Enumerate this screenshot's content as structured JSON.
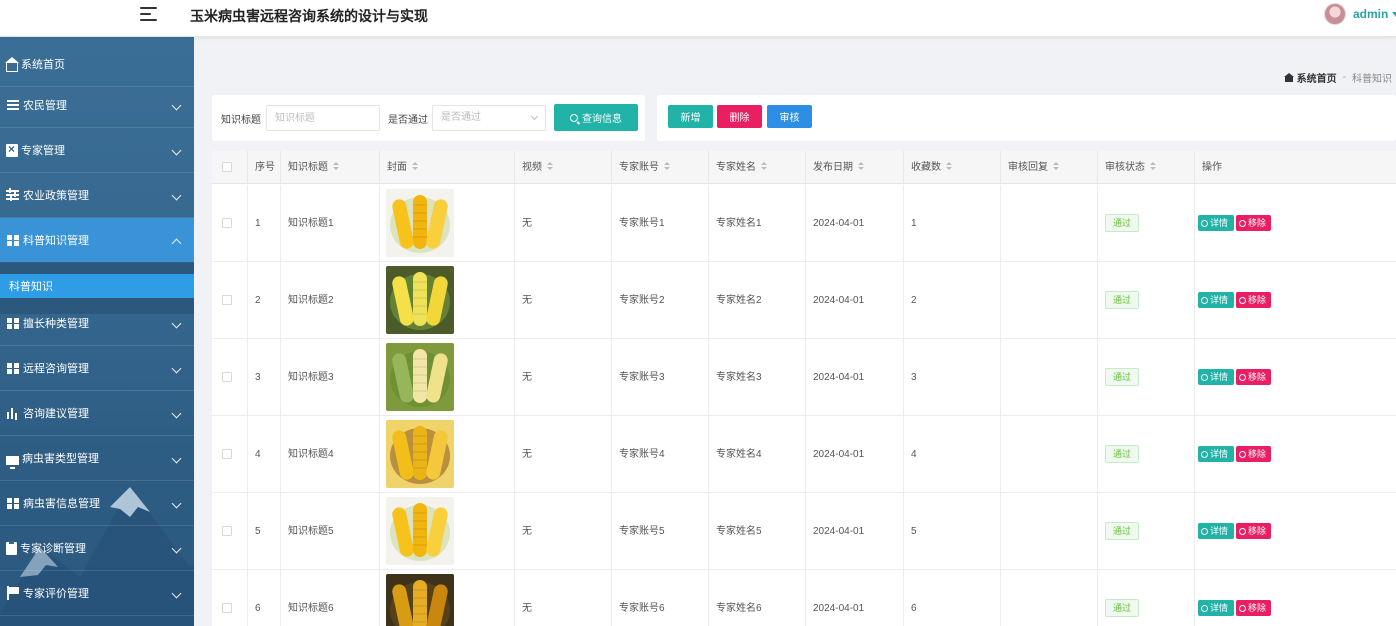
{
  "header": {
    "title": "玉米病虫害远程咨询系统的设计与实现",
    "username": "admin"
  },
  "sidebar": {
    "items": [
      {
        "label": "系统首页",
        "icon": "home-icon"
      },
      {
        "label": "农民管理",
        "icon": "list-icon"
      },
      {
        "label": "专家管理",
        "icon": "book-icon"
      },
      {
        "label": "农业政策管理",
        "icon": "sliders-icon"
      },
      {
        "label": "科普知识管理",
        "icon": "grid-icon"
      },
      {
        "label": "擅长种类管理",
        "icon": "grid-icon"
      },
      {
        "label": "远程咨询管理",
        "icon": "grid-icon"
      },
      {
        "label": "咨询建议管理",
        "icon": "bar-chart-icon"
      },
      {
        "label": "病虫害类型管理",
        "icon": "monitor-icon"
      },
      {
        "label": "病虫害信息管理",
        "icon": "grid-icon"
      },
      {
        "label": "专家诊断管理",
        "icon": "clipboard-icon"
      },
      {
        "label": "专家评价管理",
        "icon": "flag-icon"
      }
    ],
    "sub_item": "科普知识"
  },
  "breadcrumb": {
    "home": "系统首页",
    "separator": "-",
    "current": "科普知识"
  },
  "search": {
    "title_label": "知识标题",
    "title_placeholder": "知识标题",
    "pass_label": "是否通过",
    "pass_placeholder": "是否通过",
    "search_button": "查询信息"
  },
  "actions": {
    "add": "新增",
    "delete": "删除",
    "audit": "审核"
  },
  "table": {
    "columns": [
      "序号",
      "知识标题",
      "封面",
      "视频",
      "专家账号",
      "专家姓名",
      "发布日期",
      "收藏数",
      "审核回复",
      "审核状态",
      "操作"
    ],
    "rows": [
      {
        "index": "1",
        "title": "知识标题1",
        "video": "无",
        "account": "专家账号1",
        "name": "专家姓名1",
        "date": "2024-04-01",
        "favorites": "1",
        "reply": "",
        "status": "通过"
      },
      {
        "index": "2",
        "title": "知识标题2",
        "video": "无",
        "account": "专家账号2",
        "name": "专家姓名2",
        "date": "2024-04-01",
        "favorites": "2",
        "reply": "",
        "status": "通过"
      },
      {
        "index": "3",
        "title": "知识标题3",
        "video": "无",
        "account": "专家账号3",
        "name": "专家姓名3",
        "date": "2024-04-01",
        "favorites": "3",
        "reply": "",
        "status": "通过"
      },
      {
        "index": "4",
        "title": "知识标题4",
        "video": "无",
        "account": "专家账号4",
        "name": "专家姓名4",
        "date": "2024-04-01",
        "favorites": "4",
        "reply": "",
        "status": "通过"
      },
      {
        "index": "5",
        "title": "知识标题5",
        "video": "无",
        "account": "专家账号5",
        "name": "专家姓名5",
        "date": "2024-04-01",
        "favorites": "5",
        "reply": "",
        "status": "通过"
      },
      {
        "index": "6",
        "title": "知识标题6",
        "video": "无",
        "account": "专家账号6",
        "name": "专家姓名6",
        "date": "2024-04-01",
        "favorites": "6",
        "reply": "",
        "status": "通过"
      }
    ],
    "detail_label": "详情",
    "remove_label": "移除"
  },
  "colors": {
    "teal": "#22b3a8",
    "pink": "#e91e63",
    "blue": "#2d8ee6",
    "sidebar_bg": "#36688f",
    "sidebar_active": "#3a93d6"
  }
}
